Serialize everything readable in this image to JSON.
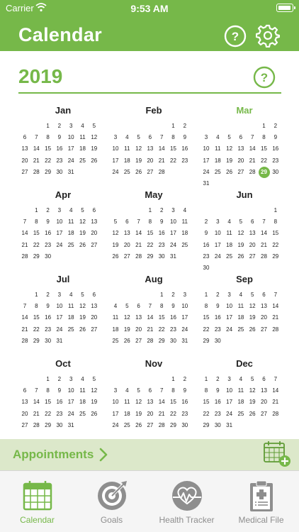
{
  "status_bar": {
    "carrier": "Carrier",
    "time": "9:53 AM"
  },
  "header": {
    "title": "Calendar",
    "help_icon": "question-circle-icon",
    "settings_icon": "gear-icon"
  },
  "year": "2019",
  "colors": {
    "accent": "#76b849",
    "appointments_bg": "#dce8ca",
    "tabbar_bg": "#f5f5f5"
  },
  "months": [
    {
      "name": "Jan",
      "days": 31,
      "start": 2
    },
    {
      "name": "Feb",
      "days": 28,
      "start": 5
    },
    {
      "name": "Mar",
      "days": 31,
      "start": 5,
      "current": true,
      "today": 29
    },
    {
      "name": "Apr",
      "days": 30,
      "start": 1
    },
    {
      "name": "May",
      "days": 31,
      "start": 3
    },
    {
      "name": "Jun",
      "days": 30,
      "start": 6
    },
    {
      "name": "Jul",
      "days": 31,
      "start": 1
    },
    {
      "name": "Aug",
      "days": 31,
      "start": 4
    },
    {
      "name": "Sep",
      "days": 30,
      "start": 0
    },
    {
      "name": "Oct",
      "days": 31,
      "start": 2
    },
    {
      "name": "Nov",
      "days": 30,
      "start": 5
    },
    {
      "name": "Dec",
      "days": 31,
      "start": 0
    }
  ],
  "appointments": {
    "label": "Appointments",
    "add_icon": "calendar-add-icon"
  },
  "tabs": [
    {
      "label": "Calendar",
      "icon": "calendar-icon",
      "active": true
    },
    {
      "label": "Goals",
      "icon": "target-icon",
      "active": false
    },
    {
      "label": "Health Tracker",
      "icon": "heart-monitor-icon",
      "active": false
    },
    {
      "label": "Medical File",
      "icon": "clipboard-icon",
      "active": false
    }
  ]
}
